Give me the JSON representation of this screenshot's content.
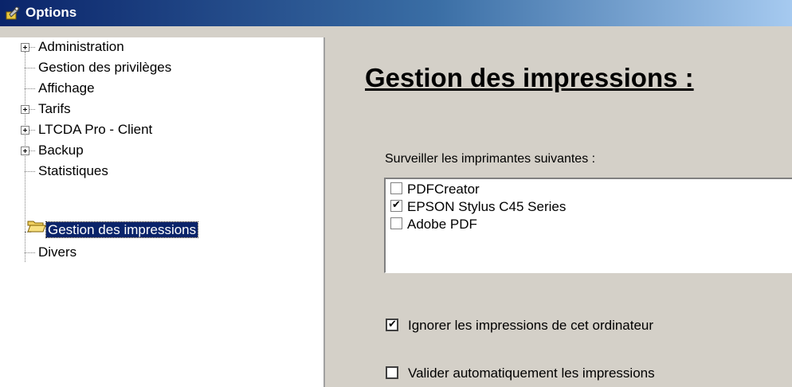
{
  "window": {
    "title": "Options",
    "icon": "options-wrench-icon"
  },
  "tree": {
    "items": [
      {
        "label": "Administration",
        "expandable": true,
        "selected": false
      },
      {
        "label": "Gestion des privilèges",
        "expandable": false,
        "selected": false
      },
      {
        "label": "Affichage",
        "expandable": false,
        "selected": false
      },
      {
        "label": "Tarifs",
        "expandable": true,
        "selected": false
      },
      {
        "label": "LTCDA Pro - Client",
        "expandable": true,
        "selected": false
      },
      {
        "label": "Backup",
        "expandable": true,
        "selected": false
      },
      {
        "label": "Statistiques",
        "expandable": false,
        "selected": false
      },
      {
        "label": "Gestion des impressions",
        "expandable": false,
        "selected": true,
        "icon": "open-folder-icon"
      },
      {
        "label": "Divers",
        "expandable": false,
        "selected": false
      }
    ]
  },
  "panel": {
    "heading": "Gestion des impressions :",
    "printers_label": "Surveiller les imprimantes suivantes :",
    "printers": [
      {
        "name": "PDFCreator",
        "checked": false
      },
      {
        "name": "EPSON Stylus C45 Series",
        "checked": true
      },
      {
        "name": "Adobe PDF",
        "checked": false
      }
    ],
    "options": [
      {
        "label": "Ignorer les impressions de cet ordinateur",
        "checked": true
      },
      {
        "label": "Valider automatiquement les impressions",
        "checked": false
      }
    ]
  },
  "colors": {
    "selection": "#0a246a",
    "titlebar_start": "#0a246a",
    "titlebar_end": "#a6caf0",
    "dialog_bg": "#d4d0c8"
  }
}
